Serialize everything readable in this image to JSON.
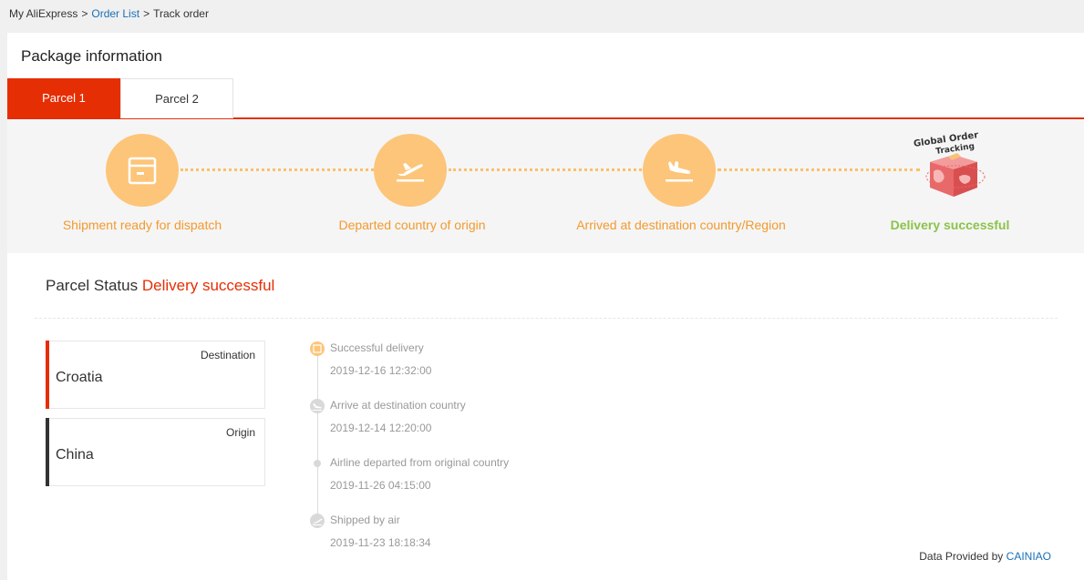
{
  "breadcrumb": {
    "home": "My AliExpress",
    "sep1": ">",
    "order_list": "Order List",
    "sep2": ">",
    "current": "Track order"
  },
  "package": {
    "title": "Package information",
    "tabs": [
      {
        "label": "Parcel 1",
        "active": true
      },
      {
        "label": "Parcel 2",
        "active": false
      }
    ]
  },
  "progress": {
    "steps": [
      {
        "label": "Shipment ready for dispatch",
        "icon": "package-box-icon"
      },
      {
        "label": "Departed country of origin",
        "icon": "plane-takeoff-icon"
      },
      {
        "label": "Arrived at destination country/Region",
        "icon": "plane-landing-icon"
      },
      {
        "label": "Delivery successful",
        "icon": "global-order-tracking-badge"
      }
    ],
    "badge_text_line1": "Global Order",
    "badge_text_line2": "Tracking"
  },
  "parcel_status": {
    "label": "Parcel Status",
    "value": "Delivery successful"
  },
  "route": {
    "destination": {
      "tag": "Destination",
      "country": "Croatia"
    },
    "origin": {
      "tag": "Origin",
      "country": "China"
    }
  },
  "timeline": [
    {
      "desc": "Successful delivery",
      "time": "2019-12-16 12:32:00"
    },
    {
      "desc": "Arrive at destination country",
      "time": "2019-12-14 12:20:00"
    },
    {
      "desc": "Airline departed from original country",
      "time": "2019-11-26 04:15:00"
    },
    {
      "desc": "Shipped by air",
      "time": "2019-11-23 18:18:34"
    }
  ],
  "provider": {
    "prefix": "Data Provided by",
    "name": "CAINIAO"
  },
  "colors": {
    "accent": "#e62e04",
    "step_orange": "#fdc579",
    "step_label": "#f29a2e",
    "success_green": "#8bc34a",
    "link_blue": "#1a6fb8"
  }
}
